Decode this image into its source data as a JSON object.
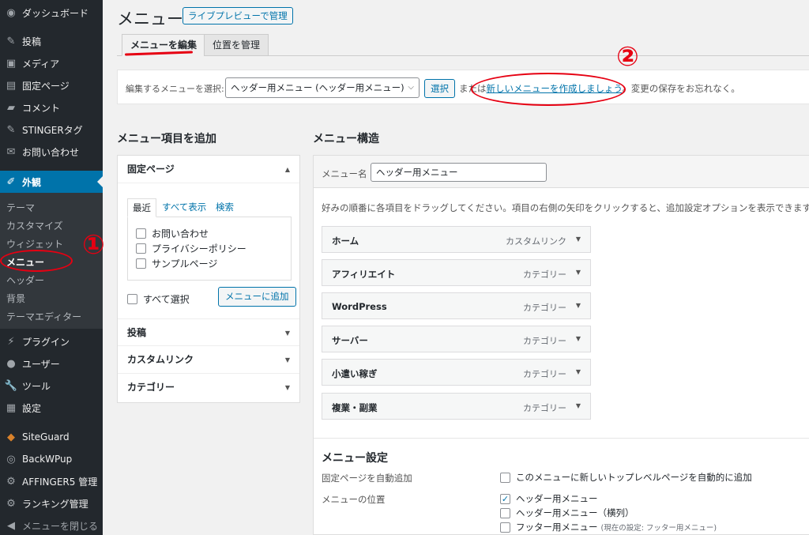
{
  "sidebar": {
    "items": [
      {
        "label": "ダッシュボード",
        "icon": "dashboard-icon",
        "glyph": "◉"
      },
      {
        "label": "投稿",
        "icon": "pin-icon",
        "glyph": "✎"
      },
      {
        "label": "メディア",
        "icon": "media-icon",
        "glyph": "▣"
      },
      {
        "label": "固定ページ",
        "icon": "page-icon",
        "glyph": "▤"
      },
      {
        "label": "コメント",
        "icon": "comment-icon",
        "glyph": "▰"
      },
      {
        "label": "STINGERタグ",
        "icon": "pin-icon",
        "glyph": "✎"
      },
      {
        "label": "お問い合わせ",
        "icon": "mail-icon",
        "glyph": "✉"
      },
      {
        "label": "外観",
        "icon": "brush-icon",
        "glyph": "✐"
      },
      {
        "label": "プラグイン",
        "icon": "plugin-icon",
        "glyph": "⚡"
      },
      {
        "label": "ユーザー",
        "icon": "user-icon",
        "glyph": "●"
      },
      {
        "label": "ツール",
        "icon": "wrench-icon",
        "glyph": "🔧"
      },
      {
        "label": "設定",
        "icon": "settings-icon",
        "glyph": "▦"
      },
      {
        "label": "SiteGuard",
        "icon": "shield-icon",
        "glyph": "◆"
      },
      {
        "label": "BackWPup",
        "icon": "backup-icon",
        "glyph": "◎"
      },
      {
        "label": "AFFINGER5 管理",
        "icon": "gear-icon",
        "glyph": "⚙"
      },
      {
        "label": "ランキング管理",
        "icon": "gear-icon",
        "glyph": "⚙"
      },
      {
        "label": "メニューを閉じる",
        "icon": "collapse-icon",
        "glyph": "◀"
      }
    ],
    "submenu": [
      "テーマ",
      "カスタマイズ",
      "ウィジェット",
      "メニュー",
      "ヘッダー",
      "背景",
      "テーマエディター"
    ]
  },
  "header": {
    "title": "メニュー",
    "live_preview_button": "ライブプレビューで管理"
  },
  "tabs": {
    "edit": "メニューを編集",
    "manage": "位置を管理"
  },
  "select_bar": {
    "label": "編集するメニューを選択:",
    "selected": "ヘッダー用メニュー (ヘッダー用メニュー)",
    "button": "選択",
    "text_before": "または",
    "link": "新しいメニューを作成しましょう",
    "text_after": "。変更の保存をお忘れなく。"
  },
  "add_items": {
    "title": "メニュー項目を追加",
    "pages_header": "固定ページ",
    "tabs": [
      "最近",
      "すべて表示",
      "検索"
    ],
    "pages": [
      "お問い合わせ",
      "プライバシーポリシー",
      "サンプルページ"
    ],
    "select_all": "すべて選択",
    "add_button": "メニューに追加",
    "sections": [
      "投稿",
      "カスタムリンク",
      "カテゴリー"
    ]
  },
  "structure": {
    "title": "メニュー構造",
    "name_label": "メニュー名",
    "name_value": "ヘッダー用メニュー",
    "instructions": "好みの順番に各項目をドラッグしてください。項目の右側の矢印をクリックすると、追加設定オプションを表示できます。",
    "items": [
      {
        "title": "ホーム",
        "type": "カスタムリンク"
      },
      {
        "title": "アフィリエイト",
        "type": "カテゴリー"
      },
      {
        "title": "WordPress",
        "type": "カテゴリー"
      },
      {
        "title": "サーバー",
        "type": "カテゴリー"
      },
      {
        "title": "小遣い稼ぎ",
        "type": "カテゴリー"
      },
      {
        "title": "複業・副業",
        "type": "カテゴリー"
      }
    ]
  },
  "settings": {
    "title": "メニュー設定",
    "auto_add_label": "固定ページを自動追加",
    "auto_add_option": "このメニューに新しいトップレベルページを自動的に追加",
    "location_label": "メニューの位置",
    "locations": [
      {
        "label": "ヘッダー用メニュー",
        "checked": true,
        "note": ""
      },
      {
        "label": "ヘッダー用メニュー（横列）",
        "checked": false,
        "note": ""
      },
      {
        "label": "フッター用メニュー",
        "checked": false,
        "note": "(現在の設定: フッター用メニュー)"
      }
    ]
  },
  "annotations": {
    "one": "①",
    "two": "②"
  },
  "colors": {
    "sidebar_bg": "#23282d",
    "active": "#0073aa",
    "annotation_red": "#e60012"
  }
}
